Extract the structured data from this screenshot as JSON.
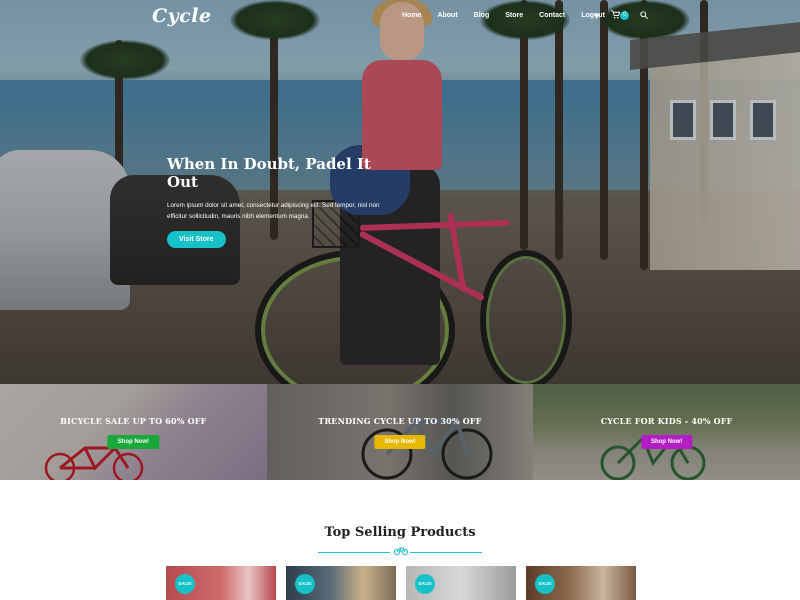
{
  "brand": {
    "logo_text": "Cycle",
    "accent_color": "#16c2c8"
  },
  "nav": {
    "items": [
      {
        "label": "Home"
      },
      {
        "label": "About"
      },
      {
        "label": "Blog"
      },
      {
        "label": "Store"
      },
      {
        "label": "Contact"
      },
      {
        "label": "Logout"
      }
    ],
    "icons": [
      "heart-icon",
      "cart-icon",
      "search-icon"
    ],
    "cart_count": "0"
  },
  "hero": {
    "title": "When In Doubt, Padel It Out",
    "description": "Lorem ipsum dolor sit amet, consectetur adipiscing elit. Sed tempor, nisl non efficitur sollicitudin, mauris nibh elementum magna.",
    "button_label": "Visit Store"
  },
  "promos": [
    {
      "title": "BICYCLE SALE UP TO 60% OFF",
      "button_label": "Shop Now!",
      "button_color": "#1aa83a"
    },
    {
      "title": "TRENDING CYCLE UP TO 30% OFF",
      "button_label": "Shop Now!",
      "button_color": "#e6b800"
    },
    {
      "title": "CYCLE FOR KIDS - 40% OFF",
      "button_label": "Shop Now!",
      "button_color": "#b21ec4"
    }
  ],
  "top_selling": {
    "title": "Top Selling Products",
    "products": [
      {
        "badge": "SALE!"
      },
      {
        "badge": "SALE!"
      },
      {
        "badge": "SALE!"
      },
      {
        "badge": "SALE!"
      }
    ]
  }
}
